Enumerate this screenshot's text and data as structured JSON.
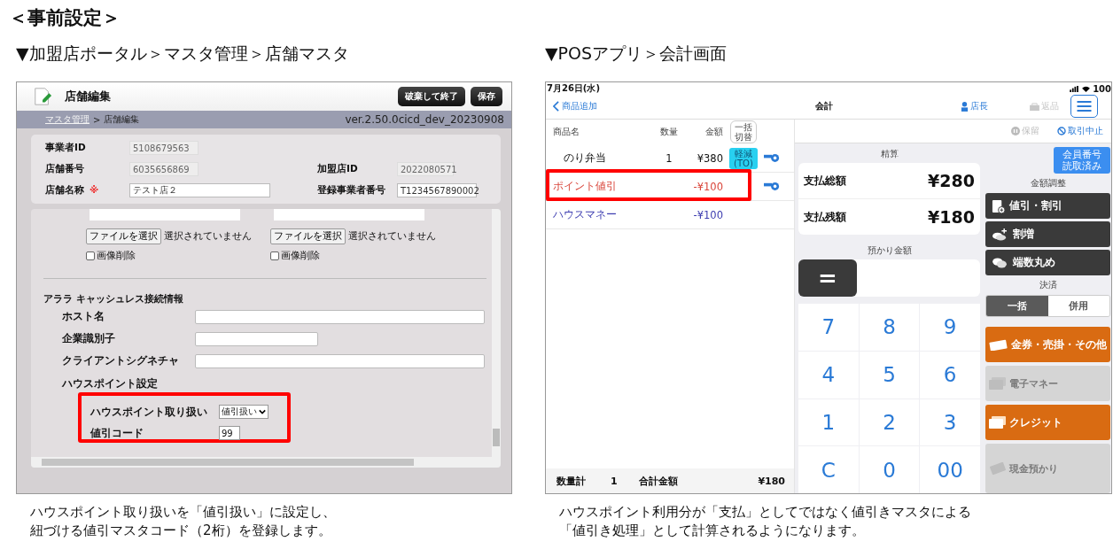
{
  "title": "＜事前設定＞",
  "portal": {
    "heading": "▼加盟店ポータル＞マスタ管理＞店舗マスタ",
    "page_title": "店舗編集",
    "header_buttons": [
      "破棄して終了",
      "保存"
    ],
    "breadcrumb": {
      "link": "マスタ管理",
      "separator": ">",
      "current": "店舗編集"
    },
    "version": "ver.2.50.0cicd_dev_20230908",
    "store_rows": [
      [
        {
          "label": "事業者ID",
          "value": "5108679563",
          "readonly": true
        }
      ],
      [
        {
          "label": "店舗番号",
          "value": "6035656869",
          "readonly": true
        },
        {
          "label": "加盟店ID",
          "value": "2022080571",
          "readonly": true
        }
      ],
      [
        {
          "label": "店舗名称",
          "required_mark": "※",
          "value": "テスト店２",
          "readonly": false
        },
        {
          "label": "登録事業者番号",
          "value": "T1234567890002",
          "readonly": false
        }
      ]
    ],
    "image_uploads": [
      {
        "button": "ファイルを選択",
        "status": "選択されていません",
        "delete_label": "画像削除",
        "delete_checked": false
      },
      {
        "button": "ファイルを選択",
        "status": "選択されていません",
        "delete_label": "画像削除",
        "delete_checked": false
      }
    ],
    "connection": {
      "heading": "アララ キャッシュレス接続情報",
      "fields": [
        {
          "label": "ホスト名"
        },
        {
          "label": "企業識別子"
        },
        {
          "label": "クライアントシグネチャ"
        }
      ]
    },
    "house_point": {
      "heading": "ハウスポイント設定",
      "highlighted": true,
      "fields": [
        {
          "label": "ハウスポイント取り扱い",
          "kind": "select",
          "value": "値引扱い"
        },
        {
          "label": "値引コード",
          "kind": "input",
          "value": "99"
        }
      ]
    },
    "caption_lines": [
      "ハウスポイント取り扱いを「値引扱い」に設定し、",
      "紐づける値引マスタコード（2桁）を登録します。"
    ]
  },
  "pos": {
    "heading": "▼POSアプリ＞会計画面",
    "status_bar": {
      "date": "7月26日(水)",
      "battery": "100"
    },
    "nav": {
      "back": "商品追加",
      "title": "会計",
      "user": "店長",
      "return_label": "返品",
      "return_disabled": true
    },
    "columns": [
      "商品名",
      "数量",
      "金額"
    ],
    "bulk_toggle": "一括切替",
    "items": [
      {
        "kind": "product",
        "name": "のり弁当",
        "qty": "1",
        "amount": "¥380",
        "tag": "軽減(TO)",
        "highlighted": false
      },
      {
        "kind": "discount",
        "name": "ポイント値引",
        "amount": "-¥100",
        "highlighted": true
      },
      {
        "kind": "payment",
        "name": "ハウスマネー",
        "amount": "-¥100",
        "highlighted": false
      }
    ],
    "footer": {
      "qty_label": "数量計",
      "qty": "1",
      "total_label": "合計金額",
      "total": "¥180"
    },
    "toolbar": [
      {
        "kind": "hold",
        "label": "保留",
        "disabled": true
      },
      {
        "kind": "cancel",
        "label": "取引中止",
        "disabled": false
      }
    ],
    "settlement": {
      "label": "精算",
      "rows": [
        {
          "label": "支払総額",
          "value": "¥280"
        },
        {
          "label": "支払残額",
          "value": "¥180"
        }
      ]
    },
    "deposit": {
      "label": "預かり金額",
      "equals": "="
    },
    "keypad": [
      "7",
      "8",
      "9",
      "4",
      "5",
      "6",
      "1",
      "2",
      "3",
      "C",
      "0",
      "00"
    ],
    "member_badge": "会員番号読取済み",
    "adjust": {
      "label": "金額調整",
      "buttons": [
        {
          "kind": "discount",
          "label": "値引・割引"
        },
        {
          "kind": "surcharge",
          "label": "割増"
        },
        {
          "kind": "rounding",
          "label": "端数丸め"
        }
      ]
    },
    "settle": {
      "label": "決済",
      "modes": [
        {
          "label": "一括",
          "selected": true
        },
        {
          "label": "併用",
          "selected": false
        }
      ],
      "methods": [
        {
          "kind": "voucher",
          "label": "金券・売掛・その他",
          "disabled": false
        },
        {
          "kind": "emoney",
          "label": "電子マネー",
          "disabled": true
        },
        {
          "kind": "credit",
          "label": "クレジット",
          "disabled": false
        },
        {
          "kind": "cash",
          "label": "現金預かり",
          "disabled": true
        }
      ]
    },
    "caption_lines": [
      "ハウスポイント利用分が「支払」としてではなく値引きマスタによる",
      "「値引き処理」として計算されるようになります。"
    ]
  }
}
